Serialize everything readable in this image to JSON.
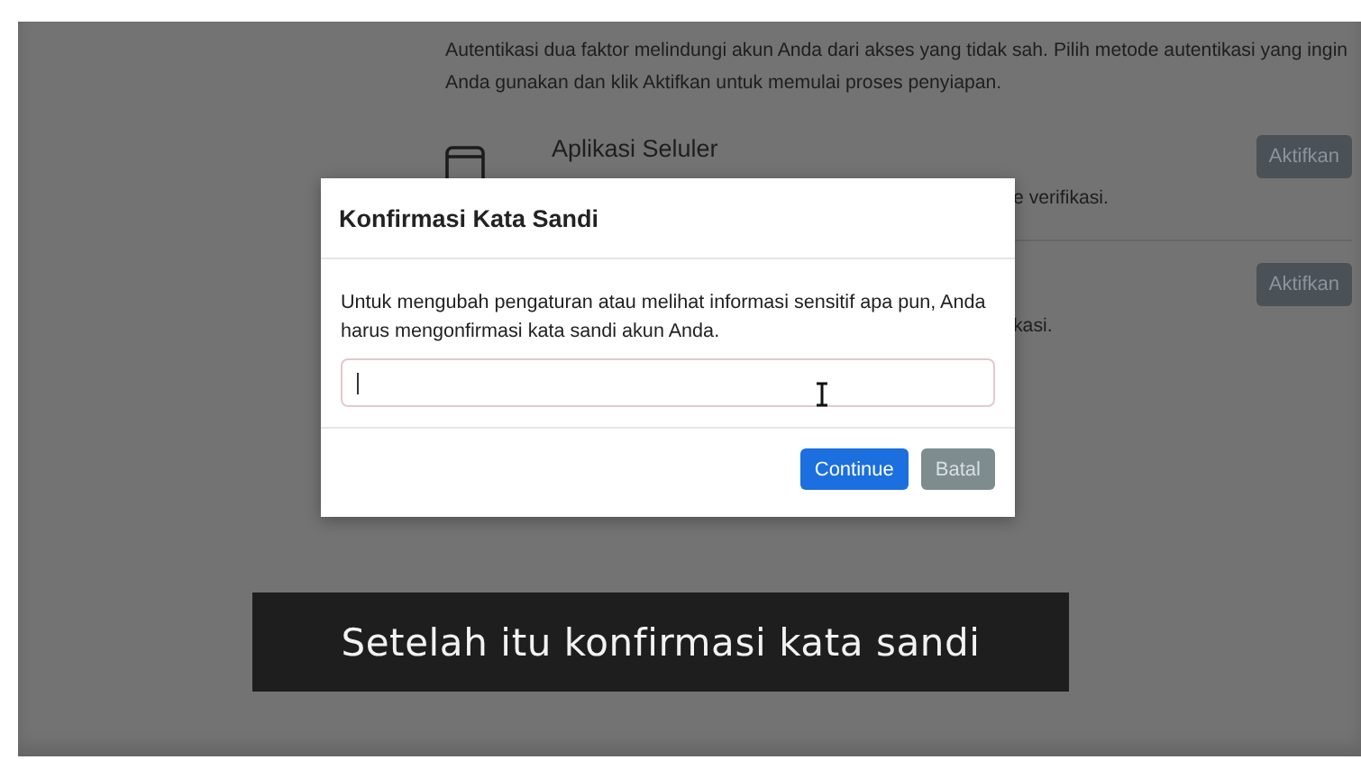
{
  "page": {
    "intro": "Autentikasi dua faktor melindungi akun Anda dari akses yang tidak sah. Pilih metode autentikasi yang ingin Anda gunakan dan klik Aktifkan untuk memulai proses penyiapan.",
    "methods": [
      {
        "title": "Aplikasi Seluler",
        "description": "e verifikasi.",
        "button": "Aktifkan"
      },
      {
        "description": "kasi.",
        "button": "Aktifkan"
      }
    ]
  },
  "dialog": {
    "title": "Konfirmasi Kata Sandi",
    "message": "Untuk mengubah pengaturan atau melihat informasi sensitif apa pun, Anda harus mengonfirmasi kata sandi akun Anda.",
    "buttons": [
      {
        "label": "Continue",
        "kind": "primary"
      },
      {
        "label": "Batal",
        "kind": "secondary"
      }
    ]
  },
  "caption": "Setelah itu konfirmasi kata sandi"
}
